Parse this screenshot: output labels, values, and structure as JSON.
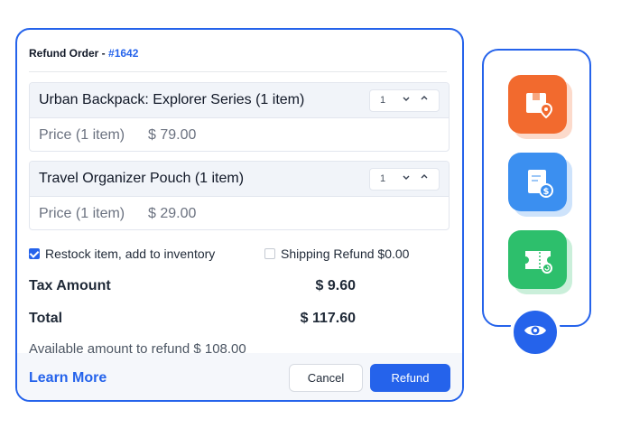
{
  "refund": {
    "title_prefix": "Refund Order - ",
    "order_id": "#1642",
    "items": [
      {
        "name": "Urban Backpack: Explorer Series (1 item)",
        "qty": "1",
        "price_label": "Price (1 item)",
        "price": "$ 79.00"
      },
      {
        "name": "Travel Organizer Pouch (1 item)",
        "qty": "1",
        "price_label": "Price (1 item)",
        "price": "$ 29.00"
      }
    ],
    "restock_label": "Restock item, add to inventory",
    "restock_checked": true,
    "shipping_label": "Shipping Refund $0.00",
    "shipping_checked": false,
    "tax_label": "Tax Amount",
    "tax_value": "$ 9.60",
    "total_label": "Total",
    "total_value": "$ 117.60",
    "available_text": "Available amount to refund $ 108.00",
    "learn_more": "Learn More",
    "cancel_label": "Cancel",
    "refund_label": "Refund"
  },
  "sidebar": {
    "icons": [
      {
        "name": "package-location-icon",
        "color": "#f26a2e"
      },
      {
        "name": "invoice-dollar-icon",
        "color": "#3b8ff0"
      },
      {
        "name": "ticket-refund-icon",
        "color": "#2dbf6c"
      }
    ],
    "eye_icon": "eye-icon"
  },
  "colors": {
    "accent": "#2563eb"
  }
}
